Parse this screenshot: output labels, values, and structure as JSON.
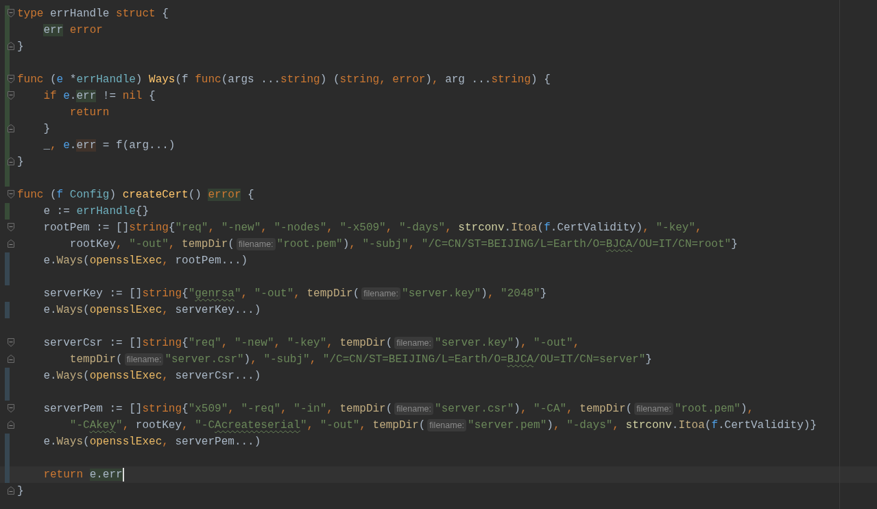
{
  "editor": {
    "lines": [
      {
        "fold_start": true,
        "fold_end": false,
        "added": true,
        "modified": false,
        "current": false,
        "tokens": [
          {
            "kind": "kw",
            "text": "type"
          },
          {
            "kind": "plain",
            "text": " errHandle "
          },
          {
            "kind": "kw",
            "text": "struct"
          },
          {
            "kind": "plain",
            "text": " {"
          }
        ]
      },
      {
        "fold_start": false,
        "fold_end": false,
        "added": true,
        "modified": false,
        "current": false,
        "tokens": [
          {
            "kind": "plain",
            "text": "    err",
            "read_highlight": true
          },
          {
            "kind": "kw",
            "text": " error"
          }
        ]
      },
      {
        "fold_start": false,
        "fold_end": true,
        "added": true,
        "modified": false,
        "current": false,
        "tokens": [
          {
            "kind": "plain",
            "text": "}"
          }
        ]
      },
      {
        "fold_start": false,
        "fold_end": false,
        "added": true,
        "modified": false,
        "current": false
      },
      {
        "fold_start": true,
        "fold_end": false,
        "added": true,
        "modified": false,
        "current": false,
        "tokens": [
          {
            "kind": "kw",
            "text": "func"
          },
          {
            "kind": "plain",
            "text": " ("
          },
          {
            "kind": "param",
            "text": "e"
          },
          {
            "kind": "plain",
            "text": " *"
          },
          {
            "kind": "type",
            "text": "errHandle"
          },
          {
            "kind": "plain",
            "text": ") "
          },
          {
            "kind": "fndecl",
            "text": "Ways"
          },
          {
            "kind": "plain",
            "text": "(f "
          },
          {
            "kind": "kw",
            "text": "func"
          },
          {
            "kind": "plain",
            "text": "(args ..."
          },
          {
            "kind": "kw",
            "text": "string"
          },
          {
            "kind": "plain",
            "text": ") ("
          },
          {
            "kind": "kw",
            "text": "string"
          },
          {
            "kind": "kw",
            "text": ", error"
          },
          {
            "kind": "plain",
            "text": ")"
          },
          {
            "kind": "kw",
            "text": ","
          },
          {
            "kind": "plain",
            "text": " arg ..."
          },
          {
            "kind": "kw",
            "text": "string"
          },
          {
            "kind": "plain",
            "text": ") {"
          }
        ]
      },
      {
        "fold_start": true,
        "fold_end": false,
        "added": true,
        "modified": false,
        "current": false,
        "tokens": [
          {
            "kind": "kw",
            "text": "    if "
          },
          {
            "kind": "param",
            "text": "e"
          },
          {
            "kind": "plain",
            "text": "."
          },
          {
            "kind": "plain",
            "text": "err",
            "read_highlight": true
          },
          {
            "kind": "plain",
            "text": " != "
          },
          {
            "kind": "kw",
            "text": "nil"
          },
          {
            "kind": "plain",
            "text": " {"
          }
        ]
      },
      {
        "fold_start": false,
        "fold_end": false,
        "added": true,
        "modified": false,
        "current": false,
        "tokens": [
          {
            "kind": "kw",
            "text": "        return"
          }
        ]
      },
      {
        "fold_start": false,
        "fold_end": true,
        "added": true,
        "modified": false,
        "current": false,
        "tokens": [
          {
            "kind": "plain",
            "text": "    }"
          }
        ]
      },
      {
        "fold_start": false,
        "fold_end": false,
        "added": true,
        "modified": false,
        "current": false,
        "tokens": [
          {
            "kind": "plain",
            "text": "    _"
          },
          {
            "kind": "kw",
            "text": ", "
          },
          {
            "kind": "param",
            "text": "e"
          },
          {
            "kind": "plain",
            "text": "."
          },
          {
            "kind": "plain",
            "text": "err",
            "write_highlight": true
          },
          {
            "kind": "plain",
            "text": " = f(arg...)"
          }
        ]
      },
      {
        "fold_start": false,
        "fold_end": true,
        "added": true,
        "modified": false,
        "current": false,
        "tokens": [
          {
            "kind": "plain",
            "text": "}"
          }
        ]
      },
      {
        "fold_start": false,
        "fold_end": false,
        "added": true,
        "modified": false,
        "current": false
      },
      {
        "fold_start": true,
        "fold_end": false,
        "added": false,
        "modified": false,
        "current": false,
        "tokens": [
          {
            "kind": "kw",
            "text": "func"
          },
          {
            "kind": "plain",
            "text": " ("
          },
          {
            "kind": "param",
            "text": "f"
          },
          {
            "kind": "type",
            "text": " Config"
          },
          {
            "kind": "plain",
            "text": ") "
          },
          {
            "kind": "fndecl",
            "text": "createCert"
          },
          {
            "kind": "plain",
            "text": "() "
          },
          {
            "kind": "kw",
            "text": "error",
            "read_highlight": true
          },
          {
            "kind": "plain",
            "text": " {"
          }
        ]
      },
      {
        "fold_start": false,
        "fold_end": false,
        "added": true,
        "modified": false,
        "current": false,
        "tokens": [
          {
            "kind": "plain",
            "text": "    e := "
          },
          {
            "kind": "type",
            "text": "errHandle"
          },
          {
            "kind": "plain",
            "text": "{}"
          }
        ]
      },
      {
        "fold_start": true,
        "fold_end": false,
        "added": false,
        "modified": false,
        "current": false,
        "tokens": [
          {
            "kind": "plain",
            "text": "    rootPem := []"
          },
          {
            "kind": "kw",
            "text": "string"
          },
          {
            "kind": "plain",
            "text": "{"
          },
          {
            "kind": "str",
            "text": "\"req\""
          },
          {
            "kind": "kw",
            "text": ", "
          },
          {
            "kind": "str",
            "text": "\"-new\""
          },
          {
            "kind": "kw",
            "text": ", "
          },
          {
            "kind": "str",
            "text": "\"-nodes\""
          },
          {
            "kind": "kw",
            "text": ", "
          },
          {
            "kind": "str",
            "text": "\"-x509\""
          },
          {
            "kind": "kw",
            "text": ", "
          },
          {
            "kind": "str",
            "text": "\"-days\""
          },
          {
            "kind": "kw",
            "text": ", "
          },
          {
            "kind": "pkg",
            "text": "strconv"
          },
          {
            "kind": "plain",
            "text": "."
          },
          {
            "kind": "call",
            "text": "Itoa"
          },
          {
            "kind": "plain",
            "text": "("
          },
          {
            "kind": "param",
            "text": "f"
          },
          {
            "kind": "plain",
            "text": ".CertValidity)"
          },
          {
            "kind": "kw",
            "text": ", "
          },
          {
            "kind": "str",
            "text": "\"-key\""
          },
          {
            "kind": "kw",
            "text": ","
          }
        ]
      },
      {
        "fold_start": false,
        "fold_end": true,
        "added": false,
        "modified": false,
        "current": false,
        "tokens": [
          {
            "kind": "plain",
            "text": "        rootKey"
          },
          {
            "kind": "kw",
            "text": ", "
          },
          {
            "kind": "str",
            "text": "\"-out\""
          },
          {
            "kind": "kw",
            "text": ", "
          },
          {
            "kind": "call",
            "text": "tempDir"
          },
          {
            "kind": "plain",
            "text": "("
          },
          {
            "kind": "hint",
            "text": "filename:"
          },
          {
            "kind": "str",
            "text": "\"root.pem\""
          },
          {
            "kind": "plain",
            "text": ")"
          },
          {
            "kind": "kw",
            "text": ", "
          },
          {
            "kind": "str",
            "text": "\"-subj\""
          },
          {
            "kind": "kw",
            "text": ", "
          },
          {
            "kind": "str",
            "text": "\"/C=CN/ST=BEIJING/L=Earth/O="
          },
          {
            "kind": "str",
            "text": "BJCA",
            "typo": true
          },
          {
            "kind": "str",
            "text": "/OU=IT/CN=root\""
          },
          {
            "kind": "plain",
            "text": "}"
          }
        ]
      },
      {
        "fold_start": false,
        "fold_end": false,
        "added": false,
        "modified": true,
        "current": false,
        "tokens": [
          {
            "kind": "plain",
            "text": "    e."
          },
          {
            "kind": "call",
            "text": "Ways"
          },
          {
            "kind": "plain",
            "text": "("
          },
          {
            "kind": "func",
            "text": "opensslExec"
          },
          {
            "kind": "kw",
            "text": ","
          },
          {
            "kind": "plain",
            "text": " rootPem...)"
          }
        ]
      },
      {
        "fold_start": false,
        "fold_end": false,
        "added": false,
        "modified": true,
        "current": false
      },
      {
        "fold_start": false,
        "fold_end": false,
        "added": false,
        "modified": false,
        "current": false,
        "tokens": [
          {
            "kind": "plain",
            "text": "    serverKey := []"
          },
          {
            "kind": "kw",
            "text": "string"
          },
          {
            "kind": "plain",
            "text": "{"
          },
          {
            "kind": "str",
            "text": "\""
          },
          {
            "kind": "str",
            "text": "genrsa",
            "typo": true
          },
          {
            "kind": "str",
            "text": "\""
          },
          {
            "kind": "kw",
            "text": ", "
          },
          {
            "kind": "str",
            "text": "\"-out\""
          },
          {
            "kind": "kw",
            "text": ", "
          },
          {
            "kind": "call",
            "text": "tempDir"
          },
          {
            "kind": "plain",
            "text": "("
          },
          {
            "kind": "hint",
            "text": "filename:"
          },
          {
            "kind": "str",
            "text": "\"server.key\""
          },
          {
            "kind": "plain",
            "text": ")"
          },
          {
            "kind": "kw",
            "text": ", "
          },
          {
            "kind": "str",
            "text": "\"2048\""
          },
          {
            "kind": "plain",
            "text": "}"
          }
        ]
      },
      {
        "fold_start": false,
        "fold_end": false,
        "added": false,
        "modified": true,
        "current": false,
        "tokens": [
          {
            "kind": "plain",
            "text": "    e."
          },
          {
            "kind": "call",
            "text": "Ways"
          },
          {
            "kind": "plain",
            "text": "("
          },
          {
            "kind": "func",
            "text": "opensslExec"
          },
          {
            "kind": "kw",
            "text": ","
          },
          {
            "kind": "plain",
            "text": " serverKey...)"
          }
        ]
      },
      {
        "fold_start": false,
        "fold_end": false,
        "added": false,
        "modified": false,
        "current": false
      },
      {
        "fold_start": true,
        "fold_end": false,
        "added": false,
        "modified": false,
        "current": false,
        "tokens": [
          {
            "kind": "plain",
            "text": "    serverCsr := []"
          },
          {
            "kind": "kw",
            "text": "string"
          },
          {
            "kind": "plain",
            "text": "{"
          },
          {
            "kind": "str",
            "text": "\"req\""
          },
          {
            "kind": "kw",
            "text": ", "
          },
          {
            "kind": "str",
            "text": "\"-new\""
          },
          {
            "kind": "kw",
            "text": ", "
          },
          {
            "kind": "str",
            "text": "\"-key\""
          },
          {
            "kind": "kw",
            "text": ", "
          },
          {
            "kind": "call",
            "text": "tempDir"
          },
          {
            "kind": "plain",
            "text": "("
          },
          {
            "kind": "hint",
            "text": "filename:"
          },
          {
            "kind": "str",
            "text": "\"server.key\""
          },
          {
            "kind": "plain",
            "text": ")"
          },
          {
            "kind": "kw",
            "text": ", "
          },
          {
            "kind": "str",
            "text": "\"-out\""
          },
          {
            "kind": "kw",
            "text": ","
          }
        ]
      },
      {
        "fold_start": false,
        "fold_end": true,
        "added": false,
        "modified": false,
        "current": false,
        "tokens": [
          {
            "kind": "call",
            "text": "        tempDir"
          },
          {
            "kind": "plain",
            "text": "("
          },
          {
            "kind": "hint",
            "text": "filename:"
          },
          {
            "kind": "str",
            "text": "\"server.csr\""
          },
          {
            "kind": "plain",
            "text": ")"
          },
          {
            "kind": "kw",
            "text": ", "
          },
          {
            "kind": "str",
            "text": "\"-subj\""
          },
          {
            "kind": "kw",
            "text": ", "
          },
          {
            "kind": "str",
            "text": "\"/C=CN/ST=BEIJING/L=Earth/O="
          },
          {
            "kind": "str",
            "text": "BJCA",
            "typo": true
          },
          {
            "kind": "str",
            "text": "/OU=IT/CN=server\""
          },
          {
            "kind": "plain",
            "text": "}"
          }
        ]
      },
      {
        "fold_start": false,
        "fold_end": false,
        "added": false,
        "modified": true,
        "current": false,
        "tokens": [
          {
            "kind": "plain",
            "text": "    e."
          },
          {
            "kind": "call",
            "text": "Ways"
          },
          {
            "kind": "plain",
            "text": "("
          },
          {
            "kind": "func",
            "text": "opensslExec"
          },
          {
            "kind": "kw",
            "text": ","
          },
          {
            "kind": "plain",
            "text": " serverCsr...)"
          }
        ]
      },
      {
        "fold_start": false,
        "fold_end": false,
        "added": false,
        "modified": true,
        "current": false
      },
      {
        "fold_start": true,
        "fold_end": false,
        "added": false,
        "modified": false,
        "current": false,
        "tokens": [
          {
            "kind": "plain",
            "text": "    serverPem := []"
          },
          {
            "kind": "kw",
            "text": "string"
          },
          {
            "kind": "plain",
            "text": "{"
          },
          {
            "kind": "str",
            "text": "\"x509\""
          },
          {
            "kind": "kw",
            "text": ", "
          },
          {
            "kind": "str",
            "text": "\"-req\""
          },
          {
            "kind": "kw",
            "text": ", "
          },
          {
            "kind": "str",
            "text": "\"-in\""
          },
          {
            "kind": "kw",
            "text": ", "
          },
          {
            "kind": "call",
            "text": "tempDir"
          },
          {
            "kind": "plain",
            "text": "("
          },
          {
            "kind": "hint",
            "text": "filename:"
          },
          {
            "kind": "str",
            "text": "\"server.csr\""
          },
          {
            "kind": "plain",
            "text": ")"
          },
          {
            "kind": "kw",
            "text": ", "
          },
          {
            "kind": "str",
            "text": "\"-CA\""
          },
          {
            "kind": "kw",
            "text": ", "
          },
          {
            "kind": "call",
            "text": "tempDir"
          },
          {
            "kind": "plain",
            "text": "("
          },
          {
            "kind": "hint",
            "text": "filename:"
          },
          {
            "kind": "str",
            "text": "\"root.pem\""
          },
          {
            "kind": "plain",
            "text": ")"
          },
          {
            "kind": "kw",
            "text": ","
          }
        ]
      },
      {
        "fold_start": false,
        "fold_end": true,
        "added": false,
        "modified": false,
        "current": false,
        "tokens": [
          {
            "kind": "str",
            "text": "        \"-C"
          },
          {
            "kind": "str",
            "text": "Akey",
            "typo": true
          },
          {
            "kind": "str",
            "text": "\""
          },
          {
            "kind": "kw",
            "text": ","
          },
          {
            "kind": "plain",
            "text": " rootKey"
          },
          {
            "kind": "kw",
            "text": ", "
          },
          {
            "kind": "str",
            "text": "\"-C"
          },
          {
            "kind": "str",
            "text": "Acreateserial",
            "typo": true
          },
          {
            "kind": "str",
            "text": "\""
          },
          {
            "kind": "kw",
            "text": ", "
          },
          {
            "kind": "str",
            "text": "\"-out\""
          },
          {
            "kind": "kw",
            "text": ", "
          },
          {
            "kind": "call",
            "text": "tempDir"
          },
          {
            "kind": "plain",
            "text": "("
          },
          {
            "kind": "hint",
            "text": "filename:"
          },
          {
            "kind": "str",
            "text": "\"server.pem\""
          },
          {
            "kind": "plain",
            "text": ")"
          },
          {
            "kind": "kw",
            "text": ", "
          },
          {
            "kind": "str",
            "text": "\"-days\""
          },
          {
            "kind": "kw",
            "text": ", "
          },
          {
            "kind": "pkg",
            "text": "strconv"
          },
          {
            "kind": "plain",
            "text": "."
          },
          {
            "kind": "call",
            "text": "Itoa"
          },
          {
            "kind": "plain",
            "text": "("
          },
          {
            "kind": "param",
            "text": "f"
          },
          {
            "kind": "plain",
            "text": ".CertValidity)}"
          }
        ]
      },
      {
        "fold_start": false,
        "fold_end": false,
        "added": false,
        "modified": true,
        "current": false,
        "tokens": [
          {
            "kind": "plain",
            "text": "    e."
          },
          {
            "kind": "call",
            "text": "Ways"
          },
          {
            "kind": "plain",
            "text": "("
          },
          {
            "kind": "func",
            "text": "opensslExec"
          },
          {
            "kind": "kw",
            "text": ","
          },
          {
            "kind": "plain",
            "text": " serverPem...)"
          }
        ]
      },
      {
        "fold_start": false,
        "fold_end": false,
        "added": false,
        "modified": true,
        "current": false
      },
      {
        "fold_start": false,
        "fold_end": false,
        "added": false,
        "modified": true,
        "current": true,
        "tokens": [
          {
            "kind": "kw",
            "text": "    return "
          },
          {
            "kind": "plain",
            "text": "e.err",
            "read_highlight": true
          }
        ]
      },
      {
        "fold_start": false,
        "fold_end": true,
        "added": false,
        "modified": false,
        "current": false,
        "tokens": [
          {
            "kind": "plain",
            "text": "}"
          }
        ]
      }
    ]
  }
}
